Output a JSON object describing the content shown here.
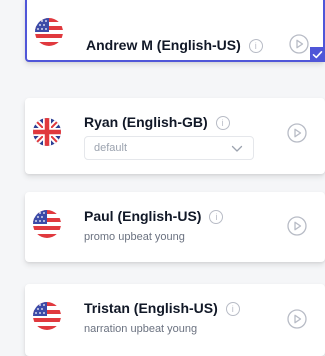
{
  "voices": [
    {
      "name": "Andrew M (English-US)",
      "flag": "us-flag-icon",
      "selected": true
    },
    {
      "name": "Ryan (English-GB)",
      "flag": "uk-flag-icon",
      "dropdown_value": "default"
    },
    {
      "name": "Paul (English-US)",
      "flag": "us-flag-icon",
      "subtitle": "promo upbeat young"
    },
    {
      "name": "Tristan (English-US)",
      "flag": "us-flag-icon",
      "subtitle": "narration upbeat young"
    }
  ],
  "info_glyph": "i",
  "icons": {
    "info": "info-icon",
    "play": "play-icon",
    "chevron": "chevron-down-icon",
    "check": "check-icon"
  },
  "colors": {
    "accent": "#4f56d8",
    "text": "#111827",
    "muted": "#6b7280",
    "icon_gray": "#b8bcc6",
    "background": "#f5f6f8"
  }
}
